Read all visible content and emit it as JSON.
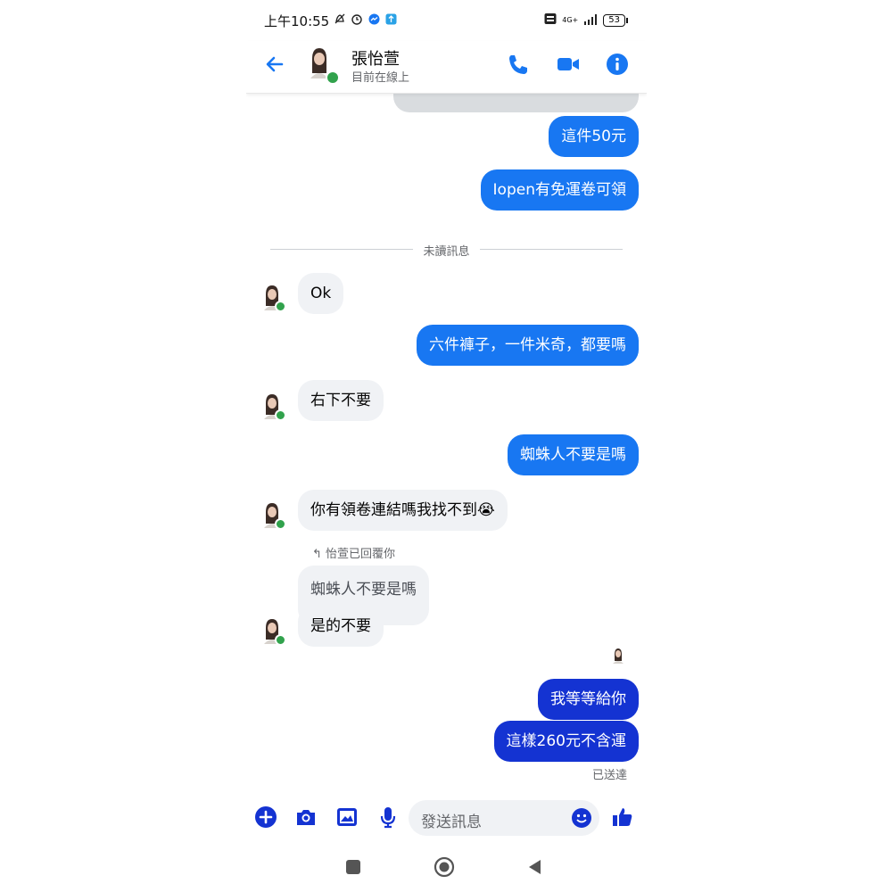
{
  "status_bar": {
    "time": "上午10:55",
    "network": "4G+",
    "battery": "53"
  },
  "header": {
    "contact_name": "張怡萱",
    "presence": "目前在線上"
  },
  "messages": [
    {
      "side": "out",
      "text": "這件50元"
    },
    {
      "side": "out",
      "text": "Iopen有免運卷可領"
    },
    {
      "side": "in",
      "text": "Ok"
    },
    {
      "side": "out",
      "text": "六件褲子，一件米奇，都要嗎"
    },
    {
      "side": "in",
      "text": "右下不要"
    },
    {
      "side": "out",
      "text": "蜘蛛人不要是嗎"
    },
    {
      "side": "in",
      "text": "你有領卷連結嗎我找不到😭"
    },
    {
      "side": "in",
      "text": "是的不要"
    },
    {
      "side": "out",
      "text": "我等等給你"
    },
    {
      "side": "out",
      "text": "這樣260元不含運"
    }
  ],
  "divider": {
    "text": "未讀訊息"
  },
  "reply": {
    "note": "怡萱已回覆你",
    "quoted_text": "蜘蛛人不要是嗎"
  },
  "delivery_status": "已送達",
  "composer": {
    "placeholder": "發送訊息"
  },
  "colors": {
    "accent": "#1877f2",
    "dark_bubble": "#1433d2",
    "incoming_bubble": "#f0f2f5",
    "online": "#31a24c"
  }
}
